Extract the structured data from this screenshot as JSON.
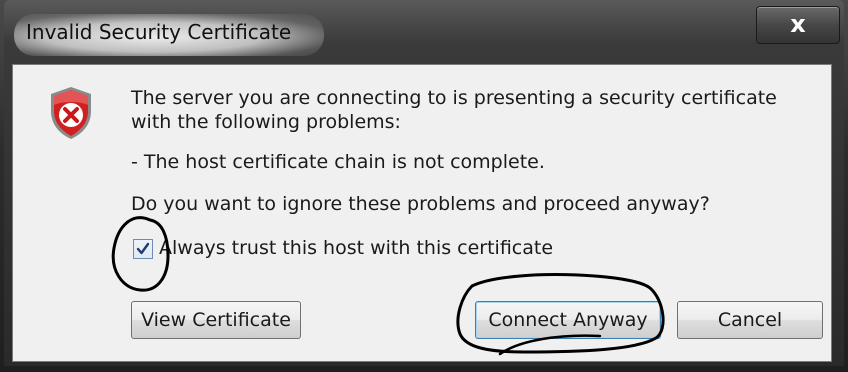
{
  "window": {
    "title": "Invalid Security Certificate",
    "close_glyph": "x"
  },
  "dialog": {
    "icon": "shield-error-icon",
    "message_line1": "The server you are connecting to is presenting a security certificate",
    "message_line2": "with the following problems:",
    "problem": "- The host certificate chain is not complete.",
    "question": "Do you want to ignore these problems and proceed anyway?",
    "always_trust_label": "Always trust this host with this certificate",
    "always_trust_checked": true
  },
  "buttons": {
    "view_certificate": "View Certificate",
    "connect_anyway": "Connect Anyway",
    "cancel": "Cancel"
  },
  "colors": {
    "title_bar": "#2d2d2d",
    "client_background": "#f0f0f0",
    "shield_red": "#d21f1f",
    "annotation_ink": "#000000"
  }
}
